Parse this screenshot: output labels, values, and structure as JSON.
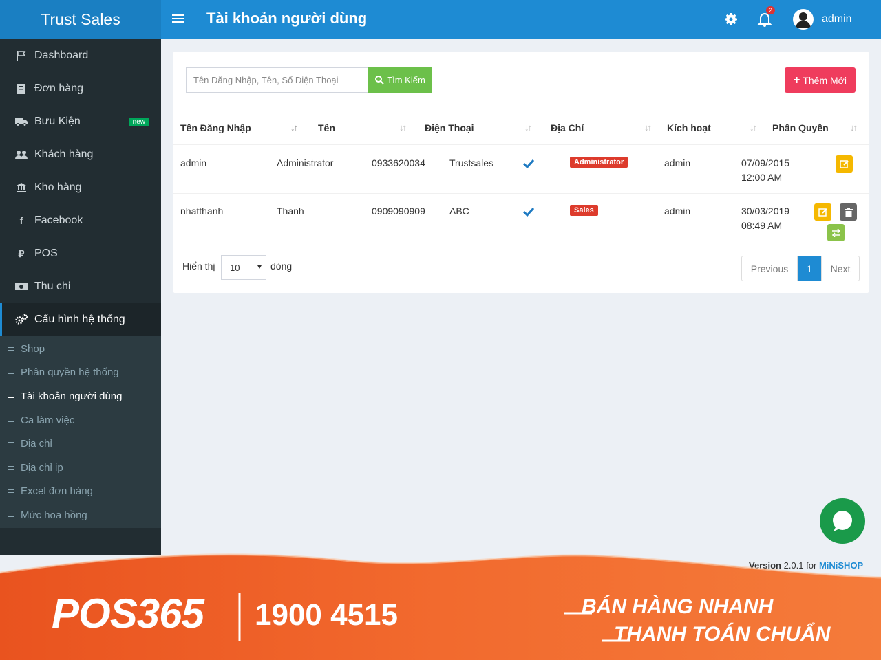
{
  "app": {
    "brand": "Trust Sales",
    "page_title": "Tài khoản người dùng",
    "notification_count": "2",
    "user": "admin"
  },
  "sidebar": {
    "items": [
      {
        "label": "Dashboard",
        "icon": "flag-icon"
      },
      {
        "label": "Đơn hàng",
        "icon": "file-icon"
      },
      {
        "label": "Bưu Kiện",
        "icon": "truck-icon",
        "badge": "new"
      },
      {
        "label": "Khách hàng",
        "icon": "users-icon"
      },
      {
        "label": "Kho hàng",
        "icon": "bank-icon"
      },
      {
        "label": "Facebook",
        "icon": "facebook-icon"
      },
      {
        "label": "POS",
        "icon": "ruble-icon"
      },
      {
        "label": "Thu chi",
        "icon": "money-icon"
      },
      {
        "label": "Cấu hình hệ thống",
        "icon": "cogs-icon"
      }
    ],
    "subitems": [
      "Shop",
      "Phân quyền hệ thống",
      "Tài khoản người dùng",
      "Ca làm việc",
      "Địa chỉ",
      "Địa chỉ ip",
      "Excel đơn hàng",
      "Mức hoa hồng"
    ]
  },
  "toolbar": {
    "search_placeholder": "Tên Đăng Nhập, Tên, Số Điện Thoại",
    "search_label": "Tìm Kiếm",
    "add_label": "Thêm Mới"
  },
  "table": {
    "headers": [
      "Tên Đăng Nhập",
      "Tên",
      "Điện Thoại",
      "Địa Chỉ",
      "Kích hoạt",
      "Phân Quyền"
    ],
    "rows": [
      {
        "username": "admin",
        "name": "Administrator",
        "phone": "0933620034",
        "address": "Trustsales",
        "active": true,
        "role": "Administrator",
        "created_by": "admin",
        "date": "07/09/2015",
        "time": "12:00 AM"
      },
      {
        "username": "nhatthanh",
        "name": "Thanh",
        "phone": "0909090909",
        "address": "ABC",
        "active": true,
        "role": "Sales",
        "created_by": "admin",
        "date": "30/03/2019",
        "time": "08:49 AM"
      }
    ]
  },
  "pagination": {
    "show_label": "Hiển thị",
    "page_length": "10",
    "rows_label": "dòng",
    "previous": "Previous",
    "current": "1",
    "next": "Next"
  },
  "footer": {
    "version_label": "Version",
    "version": "2.0.1",
    "for_label": "for",
    "product": "MiNiSHOP"
  },
  "banner": {
    "logo": "POS365",
    "phone": "1900 4515",
    "slogan_line1": "BÁN HÀNG NHANH",
    "slogan_line2": "THANH TOÁN CHUẨN"
  },
  "colors": {
    "header": "#1e8bd3",
    "sidebar": "#222d32",
    "submenu": "#2c3b41",
    "search_button": "#6cc04a",
    "add_button": "#ef3c5d",
    "role_badge": "#dd3b2c",
    "banner": "#f26a2e"
  }
}
